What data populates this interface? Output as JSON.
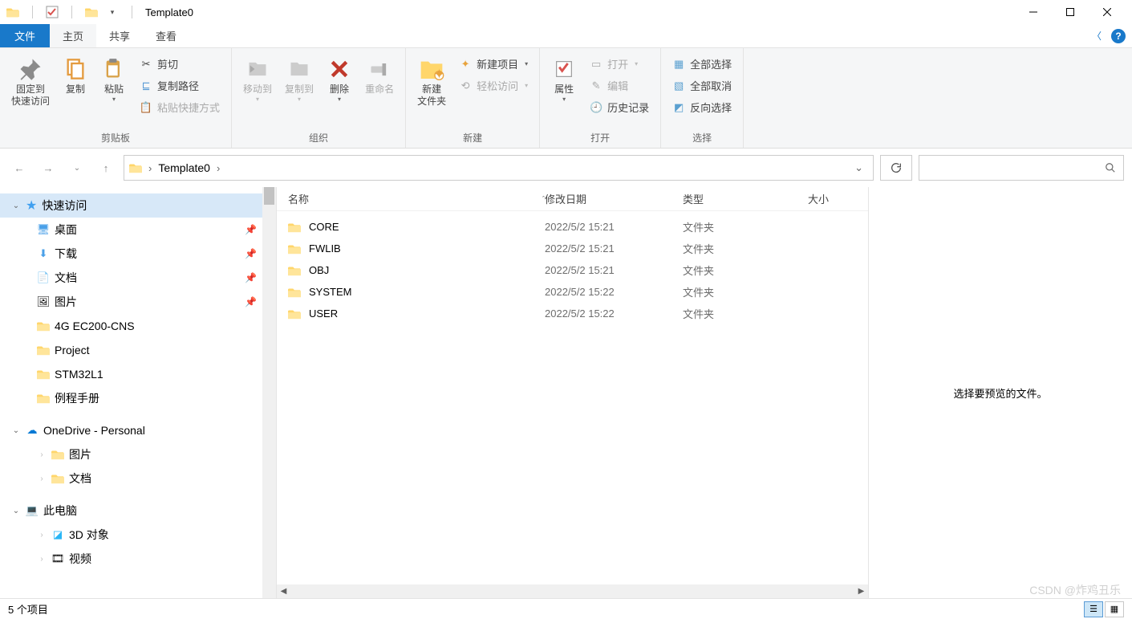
{
  "title": "Template0",
  "ribbon_tabs": {
    "file": "文件",
    "home": "主页",
    "share": "共享",
    "view": "查看"
  },
  "ribbon": {
    "clipboard": {
      "pin": "固定到\n快速访问",
      "copy": "复制",
      "paste": "粘贴",
      "cut": "剪切",
      "copypath": "复制路径",
      "pasteshortcut": "粘贴快捷方式",
      "label": "剪贴板"
    },
    "organize": {
      "moveto": "移动到",
      "copyto": "复制到",
      "delete": "删除",
      "rename": "重命名",
      "label": "组织"
    },
    "new": {
      "newfolder": "新建\n文件夹",
      "newitem": "新建项目",
      "easyaccess": "轻松访问",
      "label": "新建"
    },
    "open": {
      "props": "属性",
      "open": "打开",
      "edit": "编辑",
      "history": "历史记录",
      "label": "打开"
    },
    "select": {
      "all": "全部选择",
      "none": "全部取消",
      "invert": "反向选择",
      "label": "选择"
    }
  },
  "breadcrumb": {
    "item": "Template0"
  },
  "columns": {
    "name": "名称",
    "date": "修改日期",
    "type": "类型",
    "size": "大小"
  },
  "files": [
    {
      "name": "CORE",
      "date": "2022/5/2 15:21",
      "type": "文件夹"
    },
    {
      "name": "FWLIB",
      "date": "2022/5/2 15:21",
      "type": "文件夹"
    },
    {
      "name": "OBJ",
      "date": "2022/5/2 15:21",
      "type": "文件夹"
    },
    {
      "name": "SYSTEM",
      "date": "2022/5/2 15:22",
      "type": "文件夹"
    },
    {
      "name": "USER",
      "date": "2022/5/2 15:22",
      "type": "文件夹"
    }
  ],
  "tree": {
    "quick": "快速访问",
    "desktop": "桌面",
    "downloads": "下载",
    "documents": "文档",
    "pictures": "图片",
    "f1": "4G EC200-CNS",
    "f2": "Project",
    "f3": "STM32L1",
    "f4": "例程手册",
    "onedrive": "OneDrive - Personal",
    "od_pic": "图片",
    "od_doc": "文档",
    "thispc": "此电脑",
    "obj3d": "3D 对象",
    "videos": "视频"
  },
  "preview_hint": "选择要预览的文件。",
  "status": "5 个项目",
  "watermark": "CSDN @炸鸡丑乐"
}
